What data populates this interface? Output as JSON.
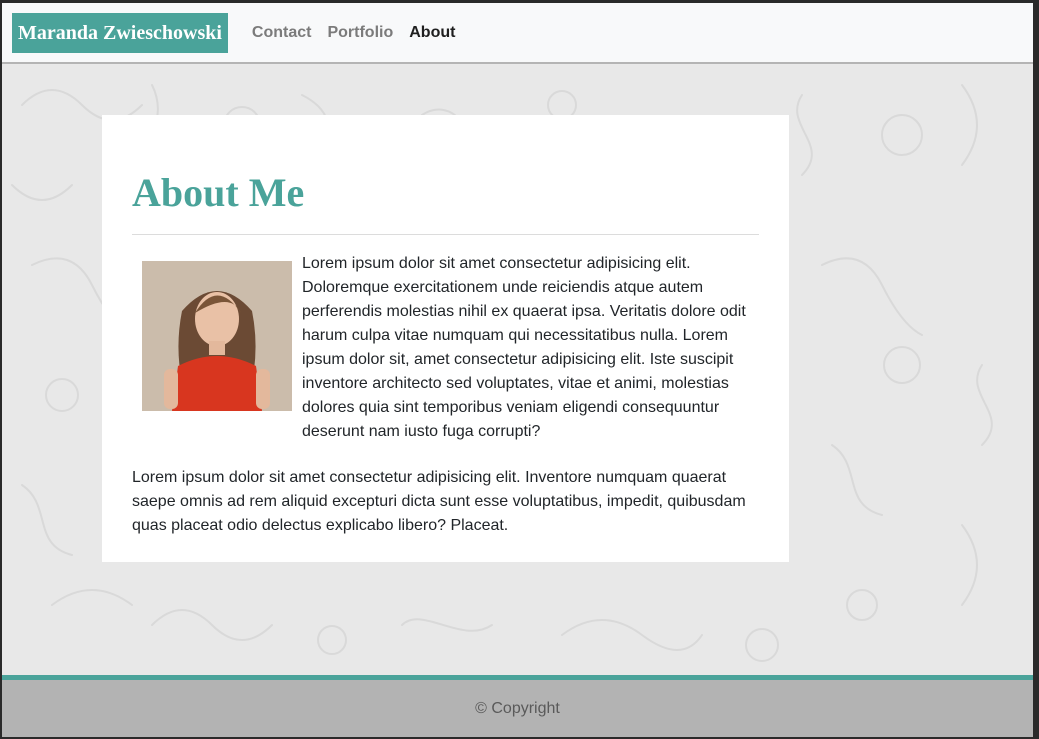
{
  "navbar": {
    "brand": "Maranda Zwieschowski",
    "links": [
      {
        "label": "Contact",
        "active": false
      },
      {
        "label": "Portfolio",
        "active": false
      },
      {
        "label": "About",
        "active": true
      }
    ]
  },
  "main": {
    "title": "About Me",
    "paragraph_1": "Lorem ipsum dolor sit amet consectetur adipisicing elit. Doloremque exercitationem unde reiciendis atque autem perferendis molestias nihil ex quaerat ipsa. Veritatis dolore odit harum culpa vitae numquam qui necessitatibus nulla. Lorem ipsum dolor sit, amet consectetur adipisicing elit. Iste suscipit inventore architecto sed voluptates, vitae et animi, molestias dolores quia sint temporibus veniam eligendi consequuntur deserunt nam iusto fuga corrupti?",
    "paragraph_2": "Lorem ipsum dolor sit amet consectetur adipisicing elit. Inventore numquam quaerat saepe omnis ad rem aliquid excepturi dicta sunt esse voluptatibus, impedit, quibusdam quas placeat odio delectus explicabo libero? Placeat."
  },
  "footer": {
    "copyright": "© Copyright"
  },
  "colors": {
    "accent": "#4aa39a",
    "navbar_bg": "#f8f9fa",
    "footer_bg": "#b3b3b3",
    "page_bg": "#e8e8e8"
  }
}
